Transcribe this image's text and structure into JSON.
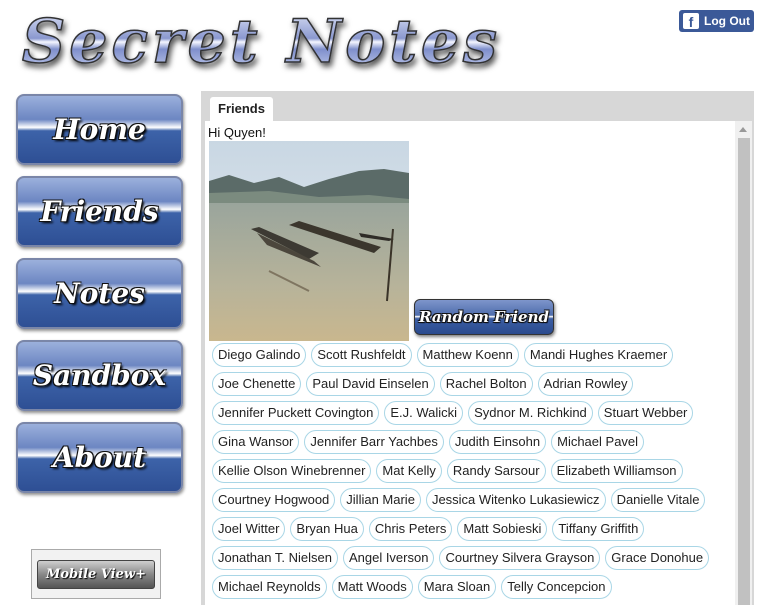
{
  "app": {
    "logo_text": "Secret Notes"
  },
  "header": {
    "logout_label": "Log Out",
    "fb_glyph": "f",
    "fb_icon": "facebook-icon"
  },
  "nav": {
    "items": [
      {
        "label": "Home"
      },
      {
        "label": "Friends"
      },
      {
        "label": "Notes"
      },
      {
        "label": "Sandbox"
      },
      {
        "label": "About"
      }
    ]
  },
  "mobile_view_label": "Mobile View+",
  "tab": {
    "label": "Friends"
  },
  "content": {
    "greeting": "Hi Quyen!",
    "random_friend_label": "Random Friend",
    "friends": [
      "Diego Galindo",
      "Scott Rushfeldt",
      "Matthew Koenn",
      "Mandi Hughes Kraemer",
      "Joe Chenette",
      "Paul David Einselen",
      "Rachel Bolton",
      "Adrian Rowley",
      "Jennifer Puckett Covington",
      "E.J. Walicki",
      "Sydnor M. Richkind",
      "Stuart Webber",
      "Gina Wansor",
      "Jennifer Barr Yachbes",
      "Judith Einsohn",
      "Michael Pavel",
      "Kellie Olson Winebrenner",
      "Mat Kelly",
      "Randy Sarsour",
      "Elizabeth Williamson",
      "Courtney Hogwood",
      "Jillian Marie",
      "Jessica Witenko Lukasiewicz",
      "Danielle Vitale",
      "Joel Witter",
      "Bryan Hua",
      "Chris Peters",
      "Matt Sobieski",
      "Tiffany Griffith",
      "Jonathan T. Nielsen",
      "Angel Iverson",
      "Courtney Silvera Grayson",
      "Grace Donohue",
      "Michael Reynolds",
      "Matt Woods",
      "Mara Sloan",
      "Telly Concepcion"
    ]
  },
  "colors": {
    "facebook_blue": "#3b5998",
    "chip_border": "#a9d6e6",
    "panel_gray": "#d7d7d7"
  }
}
